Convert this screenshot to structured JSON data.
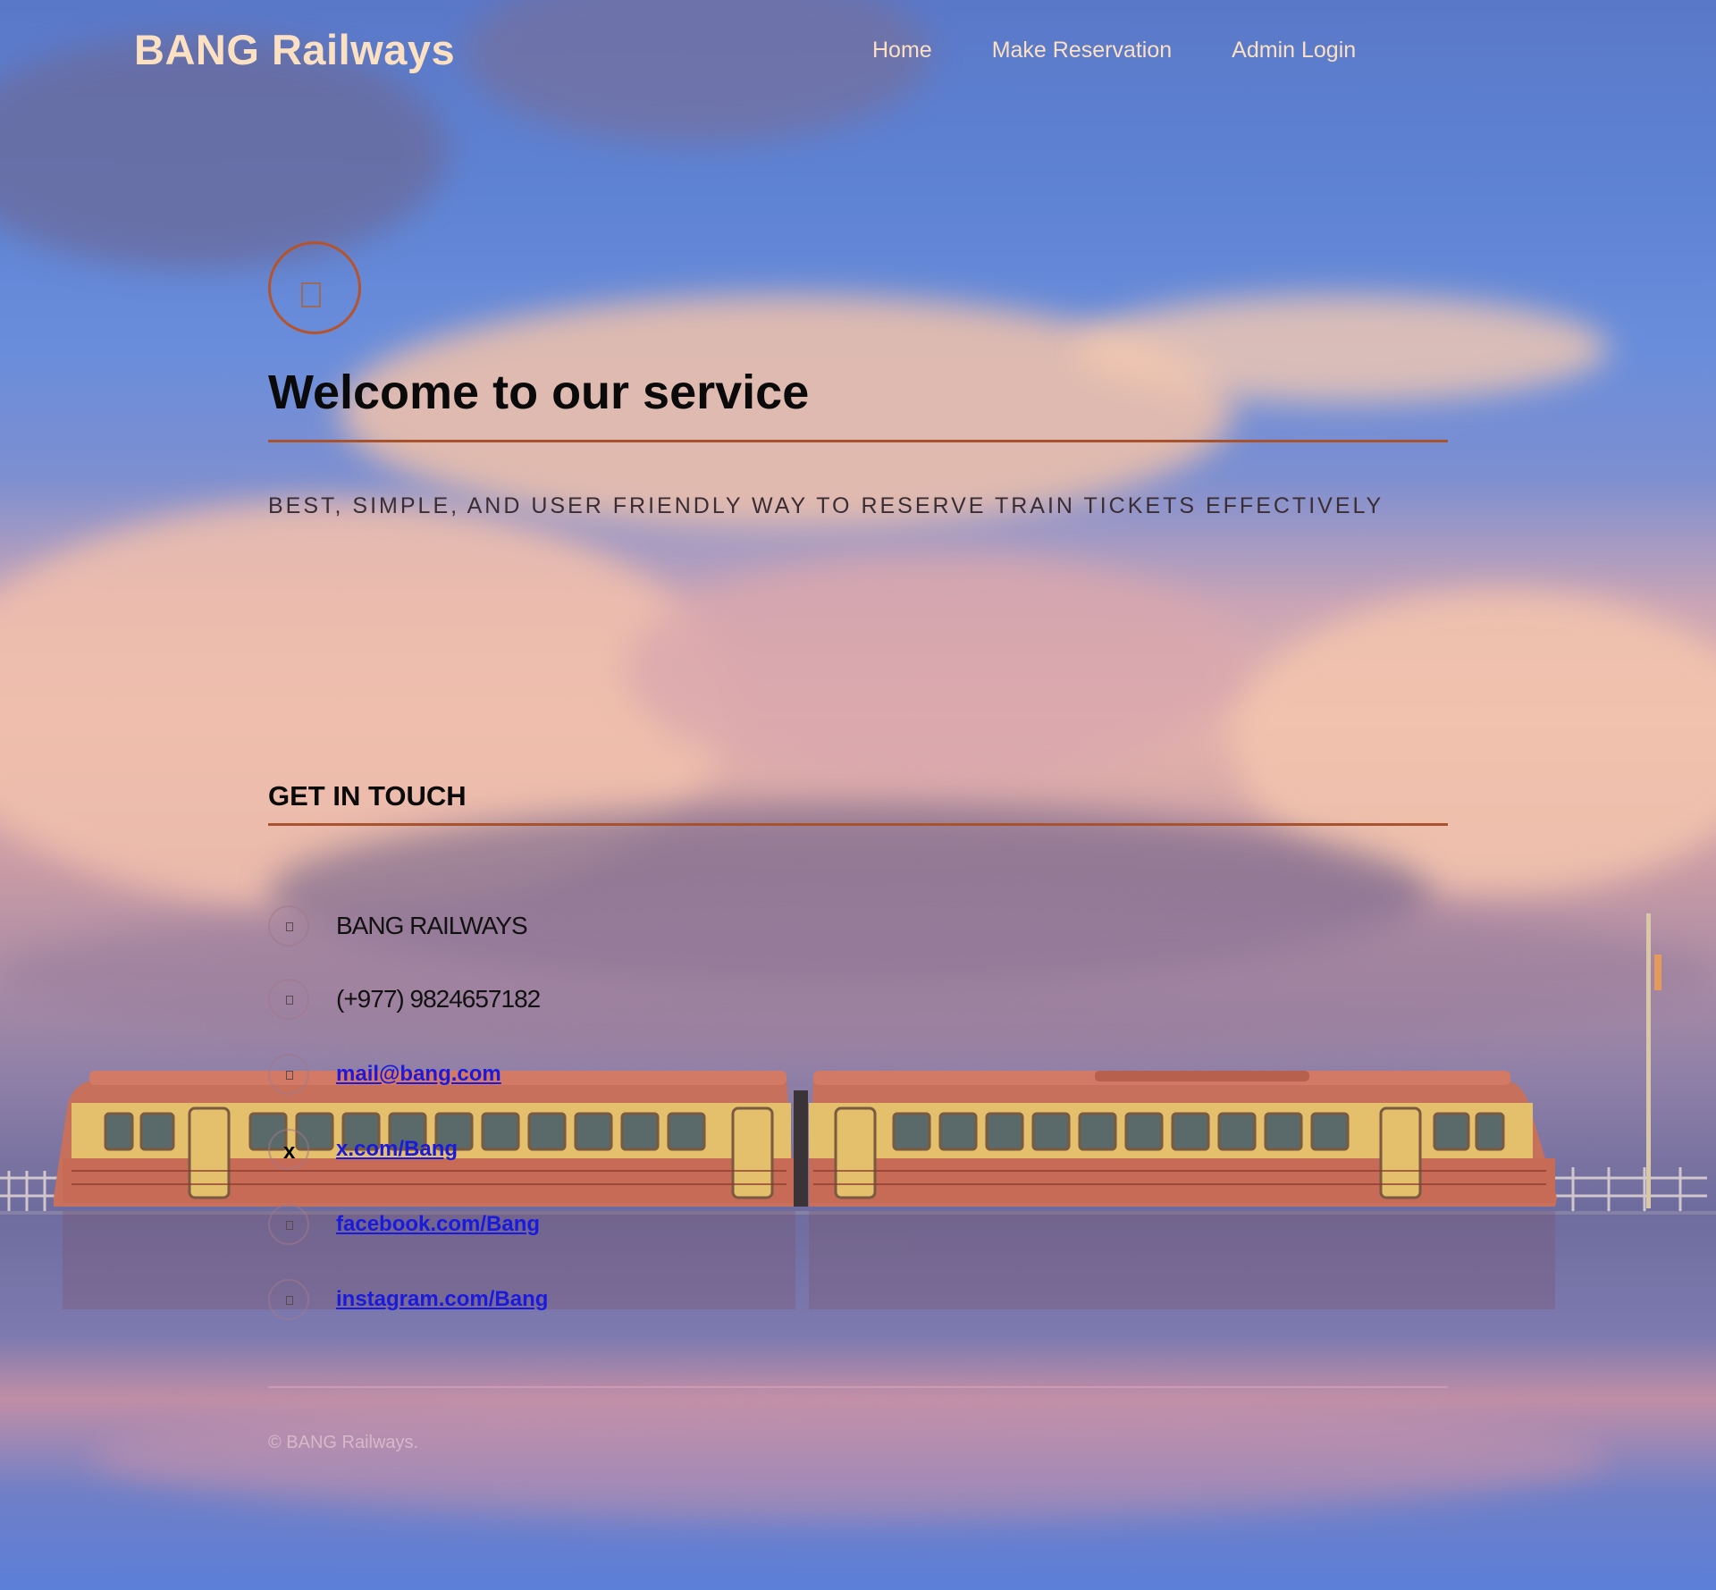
{
  "header": {
    "brand": "BANG Railways",
    "nav": [
      {
        "label": "Home"
      },
      {
        "label": "Make Reservation"
      },
      {
        "label": "Admin Login"
      }
    ]
  },
  "hero": {
    "icon": "document-icon",
    "title": "Welcome to our service",
    "tagline": "BEST, SIMPLE, AND USER FRIENDLY WAY TO RESERVE TRAIN TICKETS EFFECTIVELY"
  },
  "contact": {
    "title": "GET IN TOUCH",
    "items": [
      {
        "icon": "location-icon",
        "text": "BANG RAILWAYS"
      },
      {
        "icon": "phone-icon",
        "text": "(+977) 9824657182"
      },
      {
        "icon": "email-icon",
        "text": "mail@bang.com"
      },
      {
        "icon": "x-icon",
        "icon_glyph": "x",
        "text": "x.com/Bang"
      },
      {
        "icon": "facebook-icon",
        "text": "facebook.com/Bang"
      },
      {
        "icon": "instagram-icon",
        "text": "instagram.com/Bang"
      }
    ]
  },
  "footer": {
    "copyright": "© BANG Railways."
  },
  "colors": {
    "accent": "#a9532e",
    "brand": "#fbe0c2",
    "link": "#1a1adf"
  }
}
